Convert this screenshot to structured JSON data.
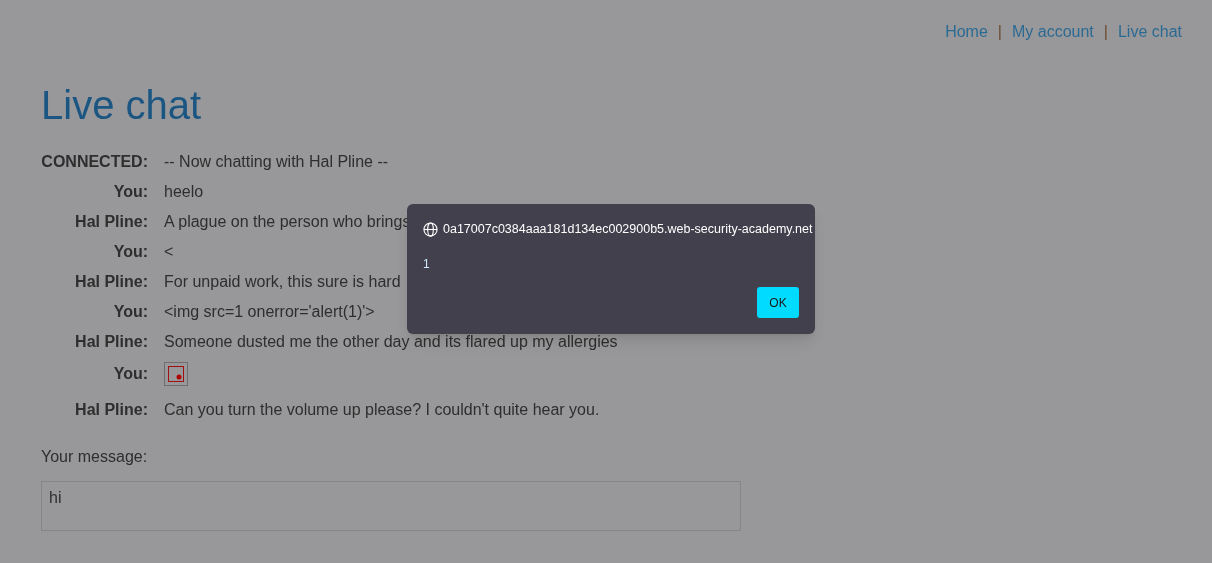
{
  "nav": {
    "links": [
      "Home",
      "My account",
      "Live chat"
    ],
    "separator": "|"
  },
  "title": "Live chat",
  "messages": [
    {
      "sender": "CONNECTED:",
      "kind": "text",
      "text": "-- Now chatting with Hal Pline --"
    },
    {
      "sender": "You:",
      "kind": "text",
      "text": "heelo"
    },
    {
      "sender": "Hal Pline:",
      "kind": "text",
      "text": "A plague on the person who brings"
    },
    {
      "sender": "You:",
      "kind": "text",
      "text": "<"
    },
    {
      "sender": "Hal Pline:",
      "kind": "text",
      "text": "For unpaid work, this sure is hard"
    },
    {
      "sender": "You:",
      "kind": "text",
      "text": "<img src=1 onerror='alert(1)'>"
    },
    {
      "sender": "Hal Pline:",
      "kind": "text",
      "text": "Someone dusted me the other day and its flared up my allergies"
    },
    {
      "sender": "You:",
      "kind": "image"
    },
    {
      "sender": "Hal Pline:",
      "kind": "text",
      "text": "Can you turn the volume up please? I couldn't quite hear you."
    }
  ],
  "message_form": {
    "label": "Your message:",
    "value": "hi"
  },
  "alert": {
    "origin": "0a17007c0384aaa181d134ec002900b5.web-security-academy.net",
    "message": "1",
    "button": "OK"
  }
}
